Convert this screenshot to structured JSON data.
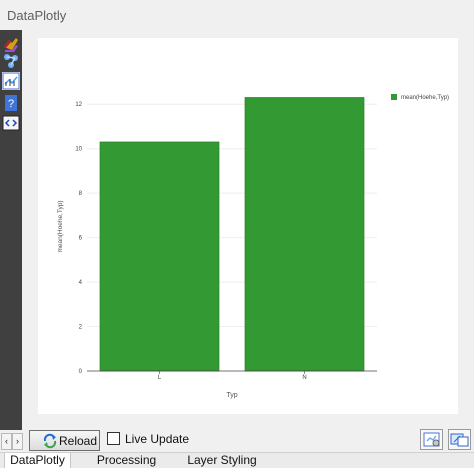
{
  "window": {
    "title": "DataPlotly"
  },
  "chart_data": {
    "type": "bar",
    "categories": [
      "L",
      "N"
    ],
    "values": [
      10.3,
      12.3
    ],
    "title": "",
    "xlabel": "Typ",
    "ylabel": "mean(Hoehe,Typ)",
    "ylim": [
      0,
      13
    ],
    "yticks": [
      0,
      2,
      4,
      6,
      8,
      10,
      12
    ],
    "legend": "mean(Hoehe,Typ)",
    "legend_position": "top-right",
    "bar_color": "#339933",
    "grid": true
  },
  "controls": {
    "reload_label": "Reload",
    "live_update_label": "Live Update"
  },
  "tabs": [
    {
      "label": "DataPlotly"
    },
    {
      "label": "Processing Toolbox"
    },
    {
      "label": "Layer Styling"
    }
  ],
  "icons": {
    "toolbar": [
      "layer-style-icon",
      "node-icon",
      "plot-icon",
      "help-icon",
      "code-icon"
    ],
    "buttons": [
      "reload-icon",
      "scroll-left-icon",
      "scroll-right-icon",
      "settings-icon",
      "panel-icon"
    ]
  }
}
